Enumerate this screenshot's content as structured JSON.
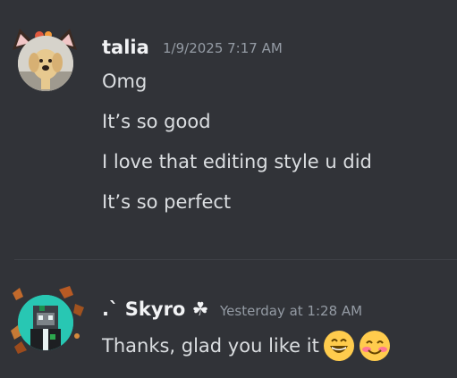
{
  "messages": [
    {
      "username": "talia",
      "timestamp": "1/9/2025 7:17 AM",
      "lines": [
        "Omg",
        "It’s so good",
        "I love that editing style u did",
        "It’s so perfect"
      ]
    },
    {
      "username": ".` Skyro ☘",
      "timestamp": "Yesterday at 1:28 AM",
      "lines": [
        "Thanks, glad you like it"
      ],
      "emojis": [
        "grinning-face",
        "smiling-face-with-blush"
      ]
    }
  ],
  "colors": {
    "background": "#313338",
    "username": "#f2f3f5",
    "timestamp": "#949ba4",
    "text": "#dbdee1",
    "divider": "#3f4147",
    "emoji_yellow": "#ffcc4d"
  }
}
